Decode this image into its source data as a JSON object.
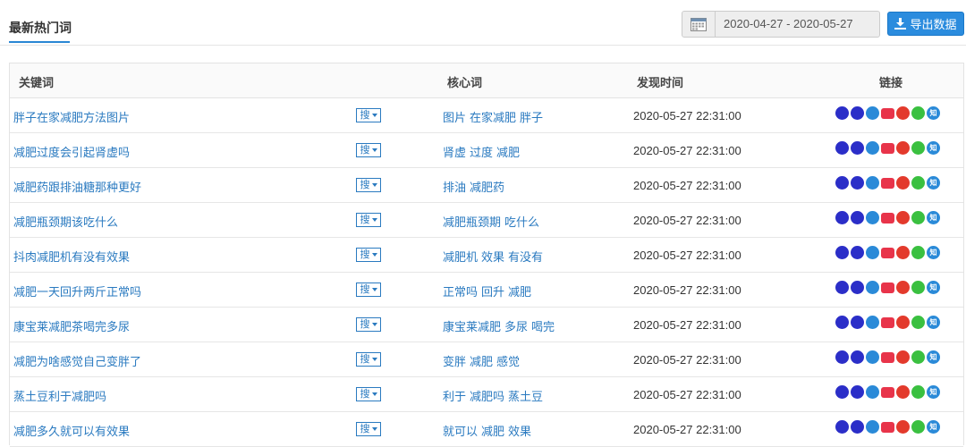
{
  "header": {
    "tab_title": "最新热门词",
    "date_range": "2020-04-27 - 2020-05-27",
    "export_label": "导出数据"
  },
  "table": {
    "columns": {
      "keyword": "关键词",
      "core": "核心词",
      "time": "发现时间",
      "links": "链接"
    },
    "search_label": "搜",
    "link_icons": [
      {
        "name": "baidu-icon",
        "glyph": "",
        "color": "#2b2ec8"
      },
      {
        "name": "360-icon",
        "glyph": "",
        "color": "#2b2ec8"
      },
      {
        "name": "sogou-icon",
        "glyph": "",
        "color": "#2a8ad8"
      },
      {
        "name": "taobao-icon",
        "glyph": "",
        "color": "#e8344a"
      },
      {
        "name": "weibo-icon",
        "glyph": "",
        "color": "#e33a2c"
      },
      {
        "name": "wechat-icon",
        "glyph": "",
        "color": "#3ac040"
      },
      {
        "name": "zhihu-icon",
        "glyph": "知",
        "color": "#2a8ad8"
      }
    ],
    "rows": [
      {
        "keyword": "胖子在家减肥方法图片",
        "core": [
          "图片",
          "在家减肥",
          "胖子"
        ],
        "time": "2020-05-27 22:31:00"
      },
      {
        "keyword": "减肥过度会引起肾虚吗",
        "core": [
          "肾虚",
          "过度",
          "减肥"
        ],
        "time": "2020-05-27 22:31:00"
      },
      {
        "keyword": "减肥药跟排油糖那种更好",
        "core": [
          "排油",
          "减肥药"
        ],
        "time": "2020-05-27 22:31:00"
      },
      {
        "keyword": "减肥瓶颈期该吃什么",
        "core": [
          "减肥瓶颈期",
          "吃什么"
        ],
        "time": "2020-05-27 22:31:00"
      },
      {
        "keyword": "抖肉减肥机有没有效果",
        "core": [
          "减肥机",
          "效果",
          "有没有"
        ],
        "time": "2020-05-27 22:31:00"
      },
      {
        "keyword": "减肥一天回升两斤正常吗",
        "core": [
          "正常吗",
          "回升",
          "减肥"
        ],
        "time": "2020-05-27 22:31:00"
      },
      {
        "keyword": "康宝莱减肥茶喝完多尿",
        "core": [
          "康宝莱减肥",
          "多尿",
          "喝完"
        ],
        "time": "2020-05-27 22:31:00"
      },
      {
        "keyword": "减肥为啥感觉自己变胖了",
        "core": [
          "变胖",
          "减肥",
          "感觉"
        ],
        "time": "2020-05-27 22:31:00"
      },
      {
        "keyword": "蒸土豆利于减肥吗",
        "core": [
          "利于",
          "减肥吗",
          "蒸土豆"
        ],
        "time": "2020-05-27 22:31:00"
      },
      {
        "keyword": "减肥多久就可以有效果",
        "core": [
          "就可以",
          "减肥",
          "效果"
        ],
        "time": "2020-05-27 22:31:00"
      }
    ]
  }
}
